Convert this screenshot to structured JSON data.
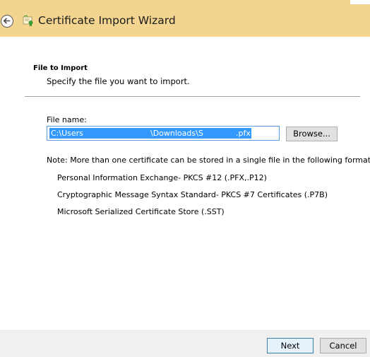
{
  "window": {
    "title": "Certificate Import Wizard",
    "back_icon": "back-arrow-icon",
    "app_icon": "certificate-icon"
  },
  "page": {
    "heading": "File to Import",
    "subheading": "Specify the file you want to import."
  },
  "file_field": {
    "label": "File name:",
    "value_segments": [
      "C:\\Users",
      "\\Downloads\\S",
      ".pfx"
    ],
    "selection_color": "#3399ff"
  },
  "buttons": {
    "browse": "Browse...",
    "next": "Next",
    "cancel": "Cancel"
  },
  "note": {
    "text": "Note:  More than one certificate can be stored in a single file in the following formats:",
    "formats": [
      "Personal Information Exchange- PKCS #12 (.PFX,.P12)",
      "Cryptographic Message Syntax Standard- PKCS #7 Certificates (.P7B)",
      "Microsoft Serialized Certificate Store (.SST)"
    ]
  },
  "colors": {
    "title_bar": "#f3d58f",
    "footer": "#f0f0f0",
    "focus_border": "#569de5"
  }
}
